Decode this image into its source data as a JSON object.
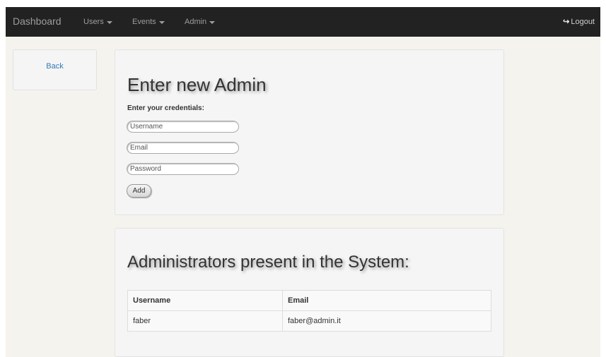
{
  "navbar": {
    "brand": "Dashboard",
    "menus": [
      {
        "label": "Users"
      },
      {
        "label": "Events"
      },
      {
        "label": "Admin"
      }
    ],
    "logout": {
      "label": "Logout",
      "icon": "logout-icon"
    }
  },
  "sidebar": {
    "back_label": "Back"
  },
  "form": {
    "title": "Enter new Admin",
    "credentials_label": "Enter your credentials:",
    "username_placeholder": "Username",
    "email_placeholder": "Email",
    "password_placeholder": "Password",
    "add_label": "Add"
  },
  "admins": {
    "title": "Administrators present in the System:",
    "headers": [
      "Username",
      "Email"
    ],
    "rows": [
      {
        "username": "faber",
        "email": "faber@admin.it"
      }
    ]
  },
  "colors": {
    "navbar_bg": "#222222",
    "page_bg": "#f5f3ee",
    "link": "#337ab7"
  }
}
